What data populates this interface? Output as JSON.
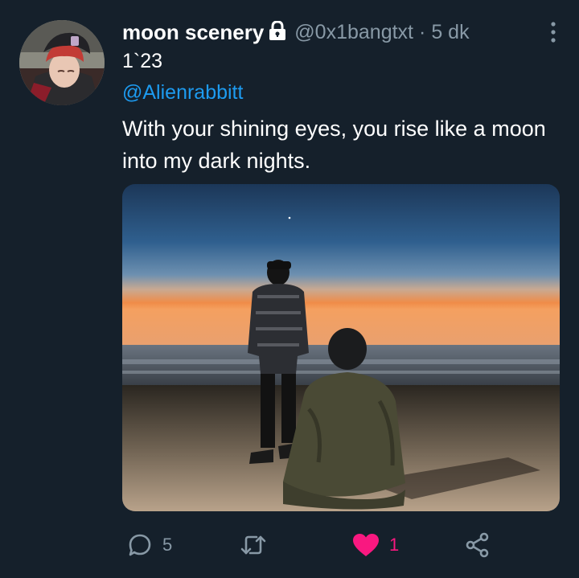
{
  "tweet": {
    "display_name": "moon scenery",
    "handle": "@0x1bangtxt",
    "separator": "·",
    "time": "5 dk",
    "subtitle": "1`23",
    "mention": "@Alienrabbitt",
    "text": "With your shining eyes, you rise like a moon into my dark nights."
  },
  "actions": {
    "reply_count": "5",
    "retweet_count": "",
    "like_count": "1",
    "like_active": true
  },
  "icons": {
    "lock": "lock-icon",
    "more": "more-vertical-icon",
    "reply": "reply-icon",
    "retweet": "retweet-icon",
    "like": "heart-icon",
    "share": "share-icon"
  },
  "colors": {
    "background": "#15202b",
    "secondary_text": "#8899a6",
    "link": "#1d9bf0",
    "like": "#f91880"
  }
}
